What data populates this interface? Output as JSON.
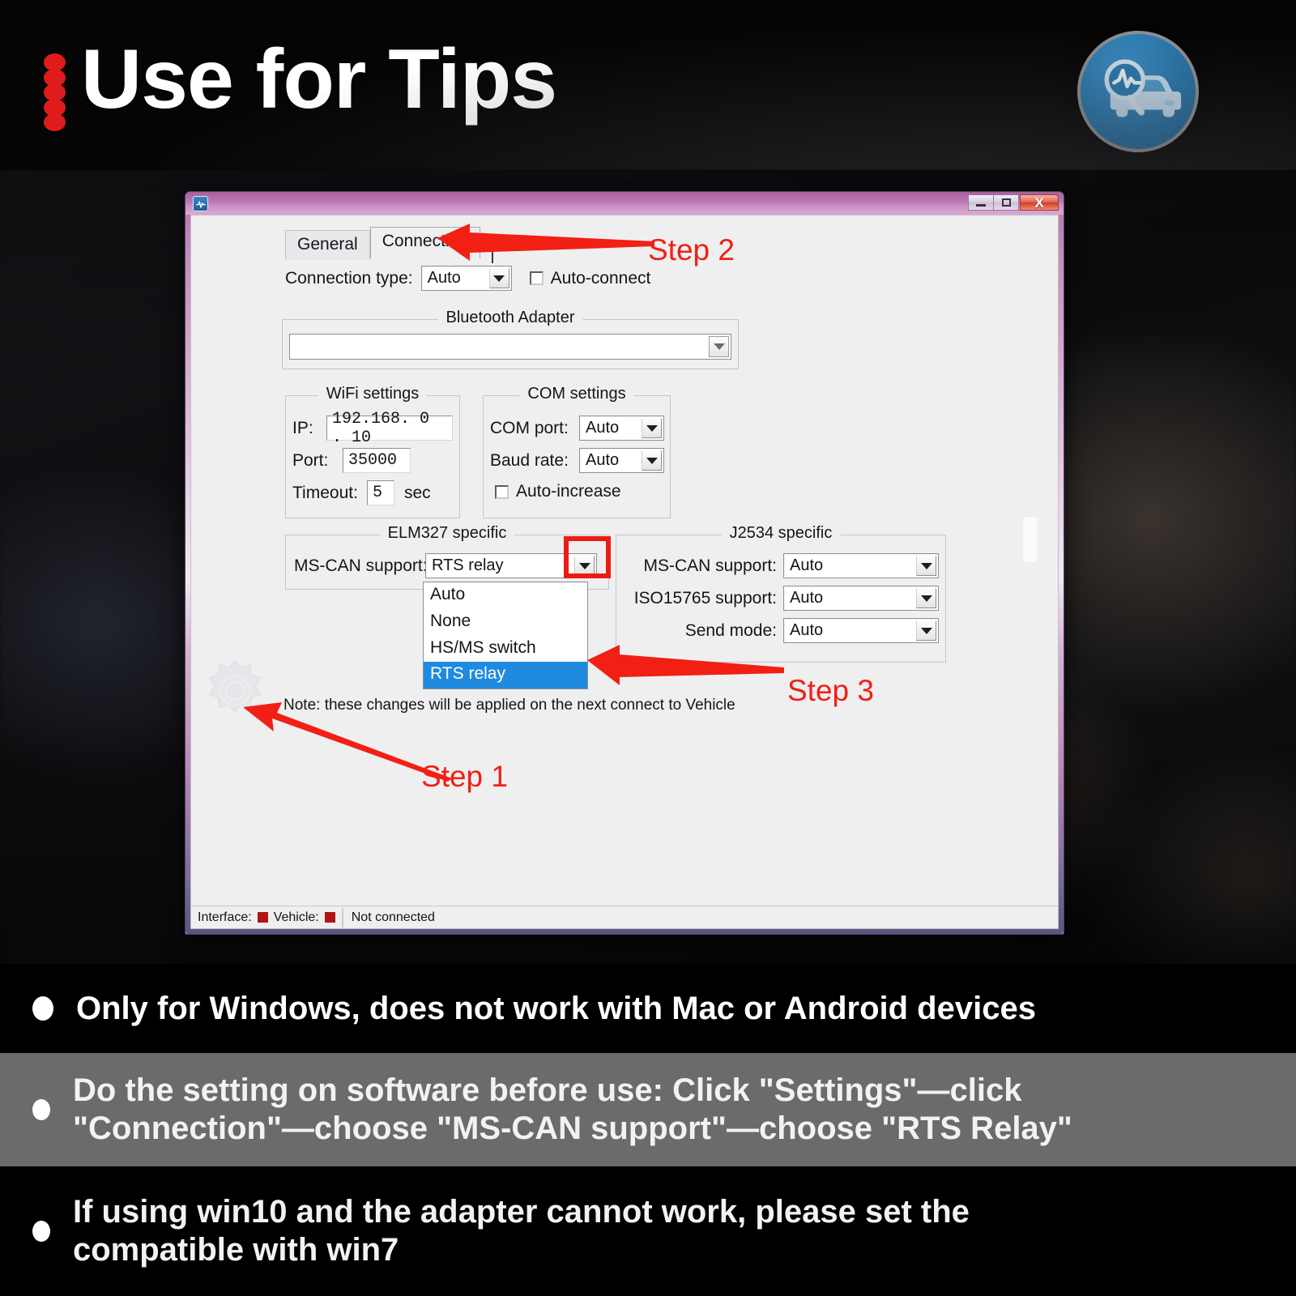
{
  "header": {
    "title": "Use for Tips",
    "logo_icon": "car-diagnostic-magnifier-icon",
    "dots_icon": "red-dots-bullet-icon"
  },
  "dialog": {
    "titlebar": {
      "app_icon": "scan-tool-icon",
      "minimize_label": "Minimize",
      "maximize_label": "Maximize",
      "close_label": "X"
    },
    "tabs": [
      {
        "label": "General",
        "active": false
      },
      {
        "label": "Connection",
        "active": true
      }
    ],
    "connection_type": {
      "label": "Connection type:",
      "value": "Auto"
    },
    "auto_connect": {
      "label": "Auto-connect",
      "checked": false
    },
    "bluetooth_adapter": {
      "title": "Bluetooth Adapter",
      "value": ""
    },
    "wifi_settings": {
      "title": "WiFi settings",
      "ip_label": "IP:",
      "ip_value": "192.168.  0  . 10",
      "port_label": "Port:",
      "port_value": "35000",
      "timeout_label": "Timeout:",
      "timeout_value": "5",
      "timeout_unit": "sec"
    },
    "com_settings": {
      "title": "COM settings",
      "com_port_label": "COM port:",
      "com_port_value": "Auto",
      "baud_rate_label": "Baud rate:",
      "baud_rate_value": "Auto",
      "auto_increase_label": "Auto-increase",
      "auto_increase_checked": false
    },
    "elm327": {
      "title": "ELM327 specific",
      "ms_can_label": "MS-CAN support:",
      "ms_can_value": "RTS relay",
      "options": [
        "Auto",
        "None",
        "HS/MS switch",
        "RTS relay"
      ],
      "selected_option": "RTS relay"
    },
    "j2534": {
      "title": "J2534 specific",
      "rows": [
        {
          "label": "MS-CAN support:",
          "value": "Auto"
        },
        {
          "label": "ISO15765 support:",
          "value": "Auto"
        },
        {
          "label": "Send mode:",
          "value": "Auto"
        }
      ]
    },
    "note": "Note: these changes will be applied on the next connect to Vehicle",
    "gear_icon": "gear-icon",
    "statusbar": {
      "interface_label": "Interface:",
      "vehicle_label": "Vehicle:",
      "status_text": "Not connected",
      "led_color": "#b01515"
    }
  },
  "annotations": {
    "accent_color": "#f21f14",
    "step1": "Step 1",
    "step2": "Step 2",
    "step3": "Step 3"
  },
  "bullets": [
    {
      "text": "Only for Windows, does not work with Mac or Android devices",
      "background": "#000000"
    },
    {
      "text": "Do the setting on software before use: Click \"Settings\"—click \"Connection\"—choose \"MS-CAN support\"—choose \"RTS Relay\"",
      "background": "#6b6b6b"
    },
    {
      "text": "If using win10 and the adapter cannot work, please set the compatible with win7",
      "background": "#000000"
    }
  ]
}
